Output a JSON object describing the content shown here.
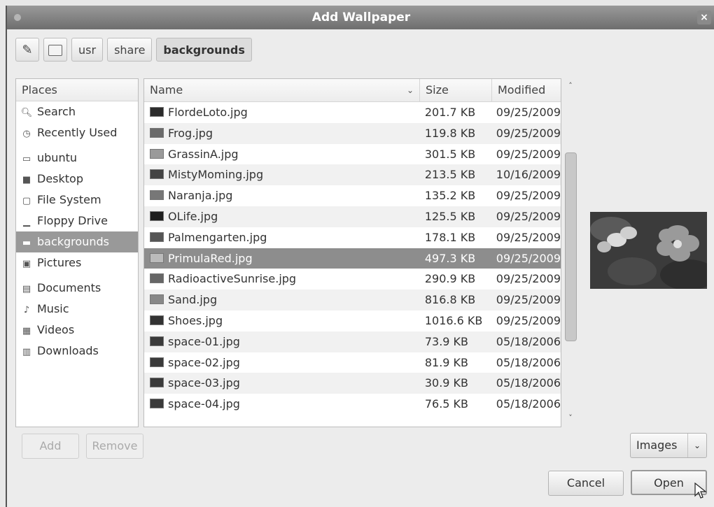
{
  "window": {
    "title": "Add Wallpaper",
    "close_glyph": "×"
  },
  "pathbar": {
    "edit_icon": "pencil-icon",
    "root_icon": "hard-disk-icon",
    "segments": [
      "usr",
      "share",
      "backgrounds"
    ],
    "active_segment": "backgrounds"
  },
  "places": {
    "header": "Places",
    "items": [
      {
        "label": "Search",
        "icon": "search-icon"
      },
      {
        "label": "Recently Used",
        "icon": "clock-icon"
      },
      {
        "label": "ubuntu",
        "icon": "home-folder-icon"
      },
      {
        "label": "Desktop",
        "icon": "desktop-icon"
      },
      {
        "label": "File System",
        "icon": "hard-disk-icon"
      },
      {
        "label": "Floppy Drive",
        "icon": "floppy-icon"
      },
      {
        "label": "backgrounds",
        "icon": "folder-icon",
        "selected": true
      },
      {
        "label": "Pictures",
        "icon": "pictures-folder-icon"
      },
      {
        "label": "Documents",
        "icon": "documents-folder-icon"
      },
      {
        "label": "Music",
        "icon": "music-folder-icon"
      },
      {
        "label": "Videos",
        "icon": "videos-folder-icon"
      },
      {
        "label": "Downloads",
        "icon": "downloads-folder-icon"
      }
    ]
  },
  "files": {
    "columns": {
      "name": "Name",
      "size": "Size",
      "modified": "Modified"
    },
    "sort_glyph": "⌄",
    "rows": [
      {
        "name": "FlordeLoto.jpg",
        "size": "201.7 KB",
        "modified": "09/25/2009"
      },
      {
        "name": "Frog.jpg",
        "size": "119.8 KB",
        "modified": "09/25/2009"
      },
      {
        "name": "GrassinA.jpg",
        "size": "301.5 KB",
        "modified": "09/25/2009"
      },
      {
        "name": "MistyMoming.jpg",
        "size": "213.5 KB",
        "modified": "10/16/2009"
      },
      {
        "name": "Naranja.jpg",
        "size": "135.2 KB",
        "modified": "09/25/2009"
      },
      {
        "name": "OLife.jpg",
        "size": "125.5 KB",
        "modified": "09/25/2009"
      },
      {
        "name": "Palmengarten.jpg",
        "size": "178.1 KB",
        "modified": "09/25/2009"
      },
      {
        "name": "PrimulaRed.jpg",
        "size": "497.3 KB",
        "modified": "09/25/2009",
        "selected": true
      },
      {
        "name": "RadioactiveSunrise.jpg",
        "size": "290.9 KB",
        "modified": "09/25/2009"
      },
      {
        "name": "Sand.jpg",
        "size": "816.8 KB",
        "modified": "09/25/2009"
      },
      {
        "name": "Shoes.jpg",
        "size": "1016.6 KB",
        "modified": "09/25/2009"
      },
      {
        "name": "space-01.jpg",
        "size": "73.9 KB",
        "modified": "05/18/2006"
      },
      {
        "name": "space-02.jpg",
        "size": "81.9 KB",
        "modified": "05/18/2006"
      },
      {
        "name": "space-03.jpg",
        "size": "30.9 KB",
        "modified": "05/18/2006"
      },
      {
        "name": "space-04.jpg",
        "size": "76.5 KB",
        "modified": "05/18/2006"
      }
    ]
  },
  "scrollbar": {
    "up_glyph": "˄",
    "down_glyph": "˅"
  },
  "buttons": {
    "add": "Add",
    "remove": "Remove",
    "filter": "Images",
    "filter_arrow": "⌄",
    "cancel": "Cancel",
    "open": "Open"
  }
}
